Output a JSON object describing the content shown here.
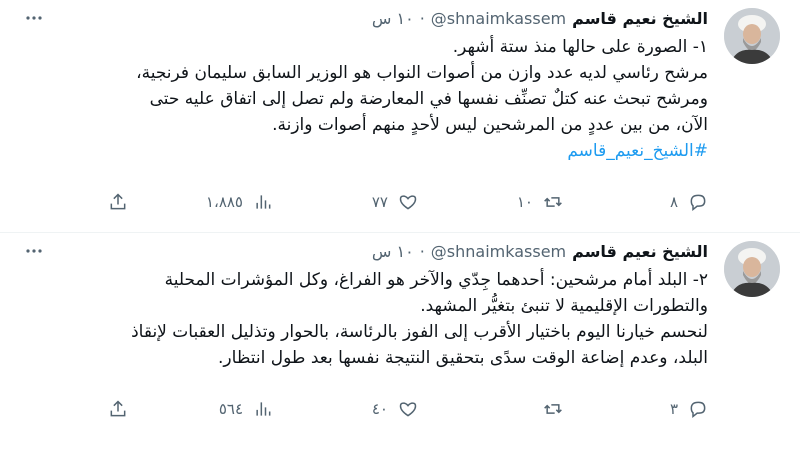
{
  "tweets": [
    {
      "author": "الشيخ نعيم قاسم",
      "handle": "@shnaimkassem",
      "separator": "·",
      "time": "١٠ س",
      "more_icon": "more-horizontal-icon",
      "lines": [
        "١- الصورة على حالها منذ ستة أشهر.",
        "مرشح رئاسي لديه عدد وازن من أصوات النواب هو الوزير السابق سليمان فرنجية،",
        "ومرشح تبحث عنه كتلٌ تصنِّف نفسها في المعارضة ولم تصل إلى اتفاق عليه حتى",
        "الآن، من بين عددٍ من المرشحين ليس لأحدٍ منهم أصوات وازنة."
      ],
      "hashtag": "#الشيخ_نعيم_قاسم",
      "replies": "٨",
      "retweets": "١٠",
      "likes": "٧٧",
      "views": "١،٨٨٥"
    },
    {
      "author": "الشيخ نعيم قاسم",
      "handle": "@shnaimkassem",
      "separator": "·",
      "time": "١٠ س",
      "more_icon": "more-horizontal-icon",
      "lines": [
        "٢- البلد أمام مرشحين: أحدهما جِدّي والآخر هو الفراغ، وكل المؤشرات المحلية",
        "والتطورات الإقليمية لا تنبئ بتغيُّر المشهد.",
        "لنحسم خيارنا اليوم باختيار الأقرب إلى الفوز بالرئاسة، بالحوار وتذليل العقبات لإنقاذ",
        "البلد، وعدم إضاعة الوقت سدًى بتحقيق النتيجة نفسها بعد طول انتظار."
      ],
      "hashtag": "",
      "replies": "٣",
      "retweets": "",
      "likes": "٤٠",
      "views": "٥٦٤"
    }
  ]
}
